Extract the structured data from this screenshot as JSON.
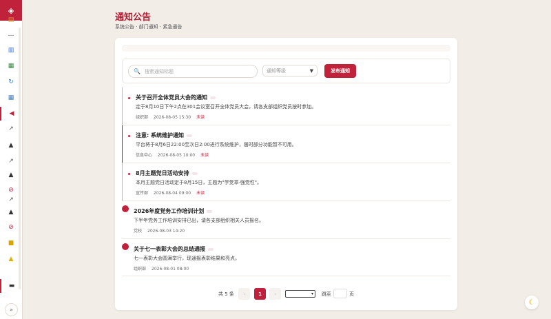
{
  "page": {
    "title": "通知公告",
    "subtitle": "系统公告 · 部门通知 · 紧急通告"
  },
  "colors": {
    "accent": "#c0213b",
    "pinned_gold": "#d8c06a",
    "background": "#f3ede7"
  },
  "sidebar": {
    "logo_icon": "diamond-logo-icon",
    "items": [
      {
        "icon": "clipboard-icon",
        "glyph": "▤",
        "color": "#d99b2b",
        "active": false
      },
      {
        "icon": "chat-icon",
        "glyph": "…",
        "color": "#444444",
        "active": false
      },
      {
        "icon": "bar-chart-icon",
        "glyph": "▥",
        "color": "#2b6fd9",
        "active": false
      },
      {
        "icon": "book-icon",
        "glyph": "▦",
        "color": "#2f8a3a",
        "active": false
      },
      {
        "icon": "refresh-icon",
        "glyph": "↻",
        "color": "#2b7fd9",
        "active": false
      },
      {
        "icon": "table-icon",
        "glyph": "▦",
        "color": "#3a7fc0",
        "active": false
      },
      {
        "icon": "megaphone-icon",
        "glyph": "◀",
        "color": "#c0213b",
        "active": true
      },
      {
        "icon": "chart-line-icon",
        "glyph": "↗",
        "color": "#555555",
        "active": false
      },
      {
        "icon": "graduation-cap-icon",
        "glyph": "▲",
        "color": "#333333",
        "active": false
      },
      {
        "icon": "chart-line-icon",
        "glyph": "↗",
        "color": "#555555",
        "active": false
      },
      {
        "icon": "graduation-cap-icon",
        "glyph": "▲",
        "color": "#333333",
        "active": false
      },
      {
        "icon": "prohibited-icon",
        "glyph": "⊘",
        "color": "#c0213b",
        "active": false
      },
      {
        "icon": "chart-line-icon",
        "glyph": "↗",
        "color": "#555555",
        "active": false
      },
      {
        "icon": "graduation-cap-icon",
        "glyph": "▲",
        "color": "#333333",
        "active": false
      },
      {
        "icon": "prohibited-icon",
        "glyph": "⊘",
        "color": "#c0213b",
        "active": false
      },
      {
        "icon": "lock-icon",
        "glyph": "■",
        "color": "#d9a400",
        "active": false
      },
      {
        "icon": "warning-icon",
        "glyph": "▲",
        "color": "#e2b000",
        "active": false
      },
      {
        "icon": "monitor-icon",
        "glyph": "▬",
        "color": "#333333",
        "active": true
      }
    ],
    "expand_label": "»"
  },
  "toolbar": {
    "search_placeholder": "搜索通知标题",
    "search_icon": "search-icon",
    "level_placeholder": "通知等级",
    "level_arrow": "▼",
    "publish_label": "发布通知"
  },
  "notices": [
    {
      "title": "关于召开全体党员大会的通知",
      "summary": "定于8月10日下午2点在301会议室召开全体党员大会，请各支部组织党员按时参加。",
      "dept": "组织部",
      "time": "2026-08-05 15:30",
      "status": "未读",
      "style": "pinned-gold"
    },
    {
      "title": "注意: 系统维护通知",
      "summary": "平台将于8月6日22:00至次日2:00进行系统维护，届时部分功能暂不可用。",
      "dept": "信息中心",
      "time": "2026-08-05 10:00",
      "status": "未读",
      "style": "pinned-red"
    },
    {
      "title": "8月主题党日活动安排",
      "summary": "本月主题党日活动定于8月15日，主题为\"学党章·强党性\"。",
      "dept": "宣传部",
      "time": "2026-08-04 09:00",
      "status": "未读",
      "style": "pinned-gold"
    },
    {
      "title": "2026年度党务工作培训计划",
      "summary": "下半年党务工作培训安排已出，请各支部组织相关人员报名。",
      "dept": "党校",
      "time": "2026-08-03 14:20",
      "status": "",
      "style": "normal"
    },
    {
      "title": "关于七一表彰大会的总结通报",
      "summary": "七一表彰大会圆满举行，现通报表彰结果和亮点。",
      "dept": "组织部",
      "time": "2026-08-01 08:00",
      "status": "",
      "style": "normal"
    }
  ],
  "pagination": {
    "total_text": "共 5 条",
    "prev": "‹",
    "current_page": "1",
    "next": "›",
    "goto_label": "跳至",
    "page_unit": "页"
  },
  "theme_toggle_icon": "moon-icon"
}
